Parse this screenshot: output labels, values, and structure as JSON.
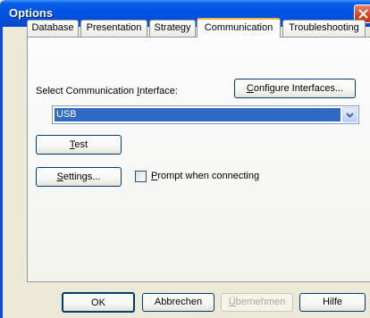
{
  "window": {
    "title": "Options"
  },
  "tabs": [
    {
      "label": "Database"
    },
    {
      "label": "Presentation"
    },
    {
      "label": "Strategy"
    },
    {
      "label": "Communication"
    },
    {
      "label": "Troubleshooting"
    }
  ],
  "active_tab": "Communication",
  "communication": {
    "interface_label_pre": "Select Communication ",
    "interface_label_key": "I",
    "interface_label_post": "nterface:",
    "configure_pre": "",
    "configure_key": "C",
    "configure_post": "onfigure Interfaces...",
    "selected_interface": "USB",
    "test_key": "T",
    "test_post": "est",
    "settings_key": "S",
    "settings_post": "ettings...",
    "prompt_key": "P",
    "prompt_post": "rompt when connecting",
    "prompt_checked": false
  },
  "footer": {
    "ok": "OK",
    "cancel": "Abbrechen",
    "apply_key": "Ü",
    "apply_post": "bernehmen",
    "help": "Hilfe"
  },
  "colors": {
    "title_bar": "#0054e3",
    "selection": "#316ac5",
    "active_tab_accent": "#f1b240"
  }
}
